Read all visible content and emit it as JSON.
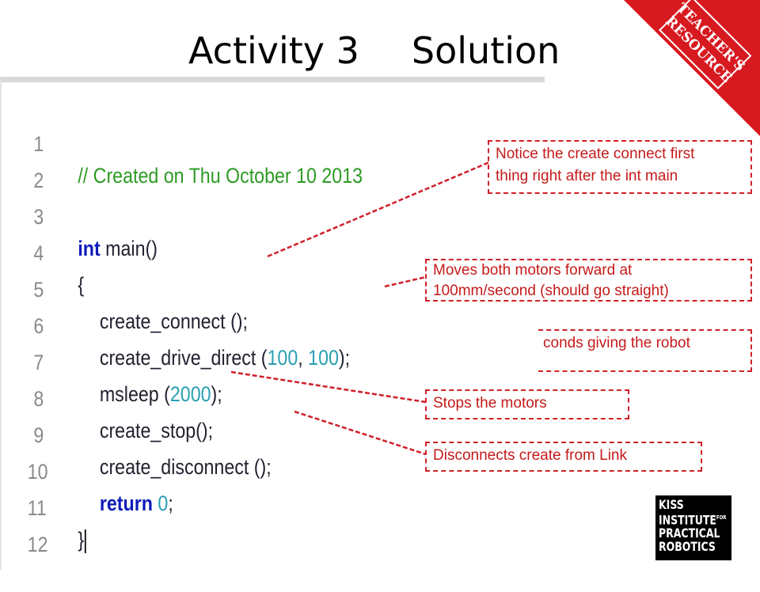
{
  "slide": {
    "title_part1": "Activity 3",
    "title_part2": "Solution"
  },
  "ribbon": {
    "line1": "TEACHER'S",
    "line2": "RESOURCE",
    "color": "#d71920"
  },
  "code_lines": [
    {
      "num": "1"
    },
    {
      "num": "2"
    },
    {
      "num": "3"
    },
    {
      "num": "4"
    },
    {
      "num": "5"
    },
    {
      "num": "6"
    },
    {
      "num": "7"
    },
    {
      "num": "8"
    },
    {
      "num": "9"
    },
    {
      "num": "10"
    },
    {
      "num": "11"
    },
    {
      "num": "12"
    }
  ],
  "code": {
    "comment": "// Created on Thu October 10 2013",
    "kw_int": "int",
    "main_sig": " main()",
    "open_brace": "{",
    "create_connect": "create_connect ();",
    "drive_fn": "create_drive_direct (",
    "drive_arg1": "100",
    "drive_sep": ", ",
    "drive_arg2": "100",
    "drive_end": ");",
    "msleep_fn": "msleep (",
    "msleep_arg": "2000",
    "msleep_end": ");",
    "create_stop": "create_stop();",
    "create_disconnect": "create_disconnect ();",
    "kw_return": "return",
    "return_val": "0",
    "return_end": ";",
    "close_brace": "}"
  },
  "callouts": {
    "connect_line1": "Notice the create connect first",
    "connect_line2": "thing right after the int main",
    "drive_line1": "Moves both motors forward at",
    "drive_line2": "100mm/second (should go straight)",
    "sleep": "conds giving the robot",
    "stop": "Stops the motors",
    "disconnect": "Disconnects create from Link"
  },
  "logo": {
    "line1": "KISS",
    "line2": "INSTITUTE",
    "line2_sup": "FOR",
    "line3": "PRACTICAL",
    "line4": "ROBOTICS"
  },
  "colors": {
    "comment": "#2e9a25",
    "keyword": "#0d1bb8",
    "number": "#2aa0b4",
    "callout": "#c41a1a"
  }
}
